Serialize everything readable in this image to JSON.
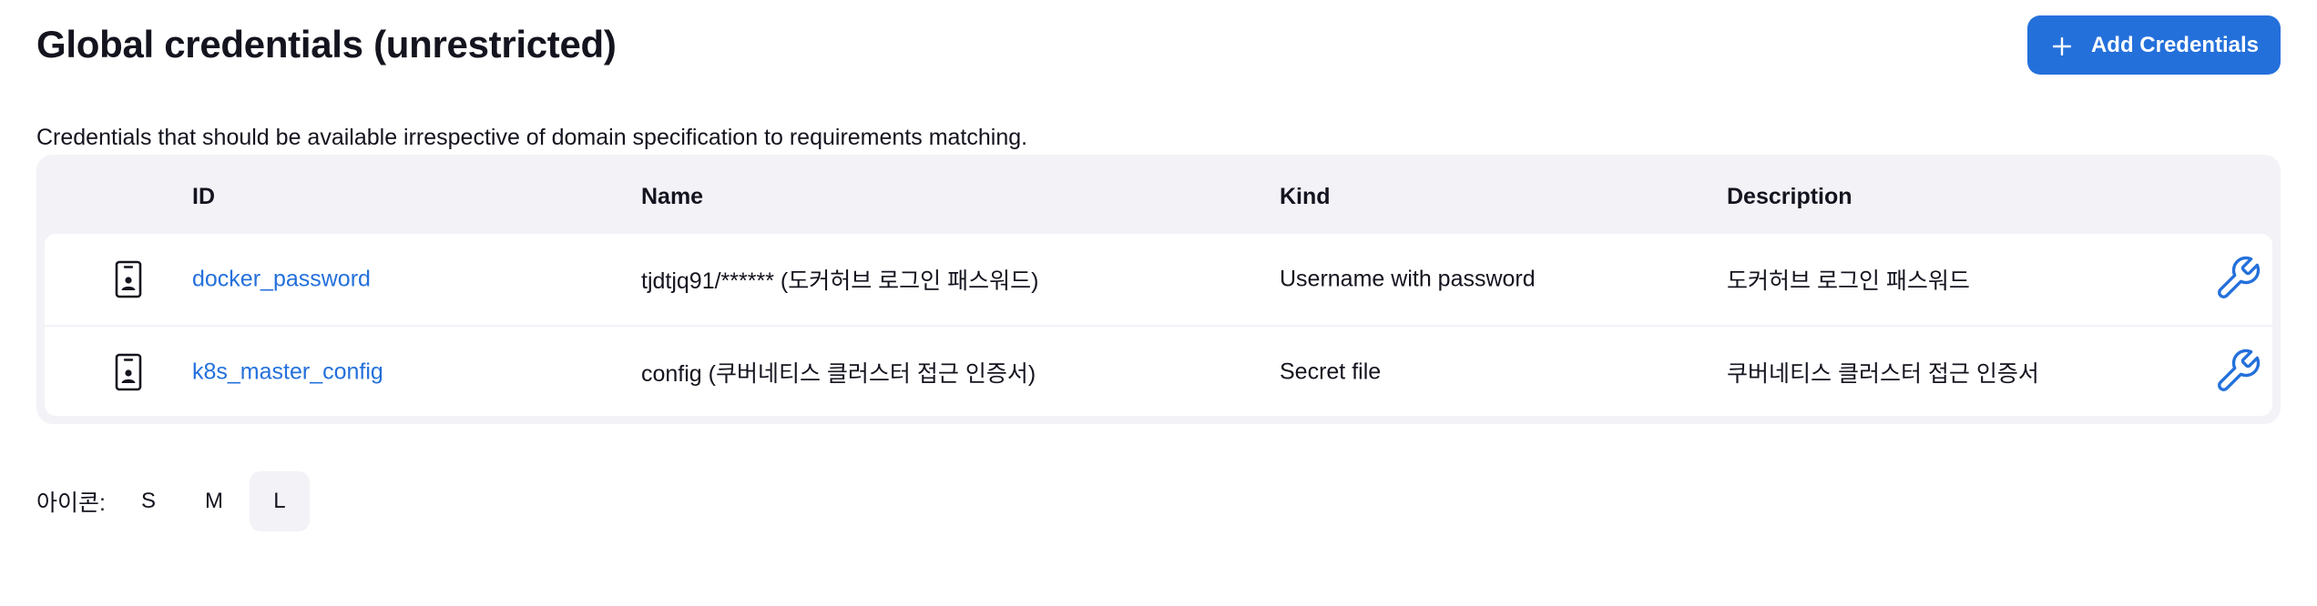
{
  "header": {
    "title": "Global credentials (unrestricted)",
    "add_button_label": "Add Credentials",
    "add_button_icon": "plus-icon",
    "accent_color": "#2470db"
  },
  "description": "Credentials that should be available irrespective of domain specification to requirements matching.",
  "table": {
    "columns": [
      "ID",
      "Name",
      "Kind",
      "Description"
    ],
    "rows": [
      {
        "icon": "mobile-credential-icon",
        "id": "docker_password",
        "name": "tjdtjq91/****** (도커허브 로그인 패스워드)",
        "kind": "Username with password",
        "description": "도커허브 로그인 패스워드",
        "action_icon": "wrench-icon"
      },
      {
        "icon": "mobile-credential-icon",
        "id": "k8s_master_config",
        "name": "config (쿠버네티스 클러스터 접근 인증서)",
        "kind": "Secret file",
        "description": "쿠버네티스 클러스터 접근 인증서",
        "action_icon": "wrench-icon"
      }
    ]
  },
  "icon_size": {
    "label": "아이콘:",
    "options": [
      "S",
      "M",
      "L"
    ],
    "selected": "L"
  }
}
